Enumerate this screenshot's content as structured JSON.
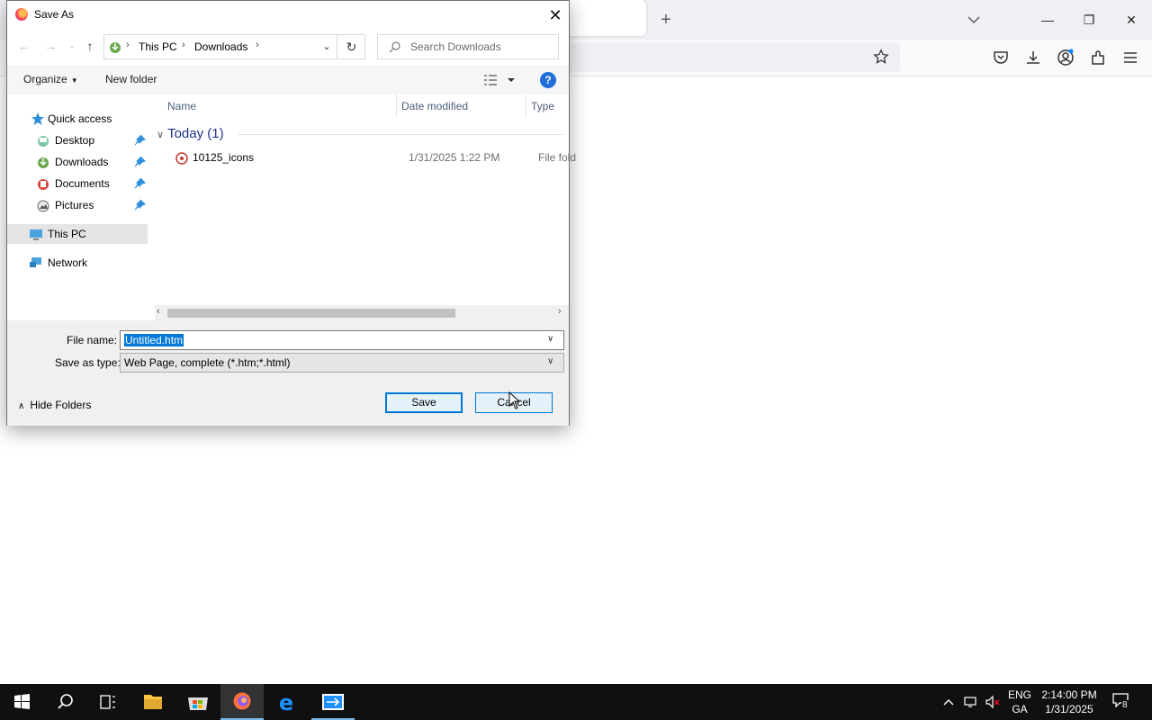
{
  "dialog": {
    "title": "Save As",
    "breadcrumb": [
      "This PC",
      "Downloads"
    ],
    "search_placeholder": "Search Downloads",
    "toolbar": {
      "organize": "Organize",
      "new_folder": "New folder"
    },
    "nav": {
      "quick_access": "Quick access",
      "items": [
        {
          "label": "Desktop",
          "icon": "desktop-icon"
        },
        {
          "label": "Downloads",
          "icon": "downloads-icon"
        },
        {
          "label": "Documents",
          "icon": "documents-icon"
        },
        {
          "label": "Pictures",
          "icon": "pictures-icon"
        }
      ],
      "this_pc": "This PC",
      "network": "Network"
    },
    "columns": {
      "name": "Name",
      "date": "Date modified",
      "type": "Type"
    },
    "group": "Today (1)",
    "files": [
      {
        "name": "10125_icons",
        "date": "1/31/2025 1:22 PM",
        "type": "File folder"
      }
    ],
    "form": {
      "file_name_label": "File name:",
      "file_name_value": "Untitled.htm",
      "save_type_label": "Save as type:",
      "save_type_value": "Web Page, complete (*.htm;*.html)",
      "hide_folders": "Hide Folders",
      "save": "Save",
      "cancel": "Cancel"
    }
  },
  "taskbar": {
    "lang_line1": "ENG",
    "lang_line2": "GA",
    "time": "2:14:00 PM",
    "date": "1/31/2025",
    "notification_count": "8"
  },
  "colors": {
    "accent": "#0078d7",
    "taskbar": "#101010",
    "selection": "#0078d7"
  }
}
